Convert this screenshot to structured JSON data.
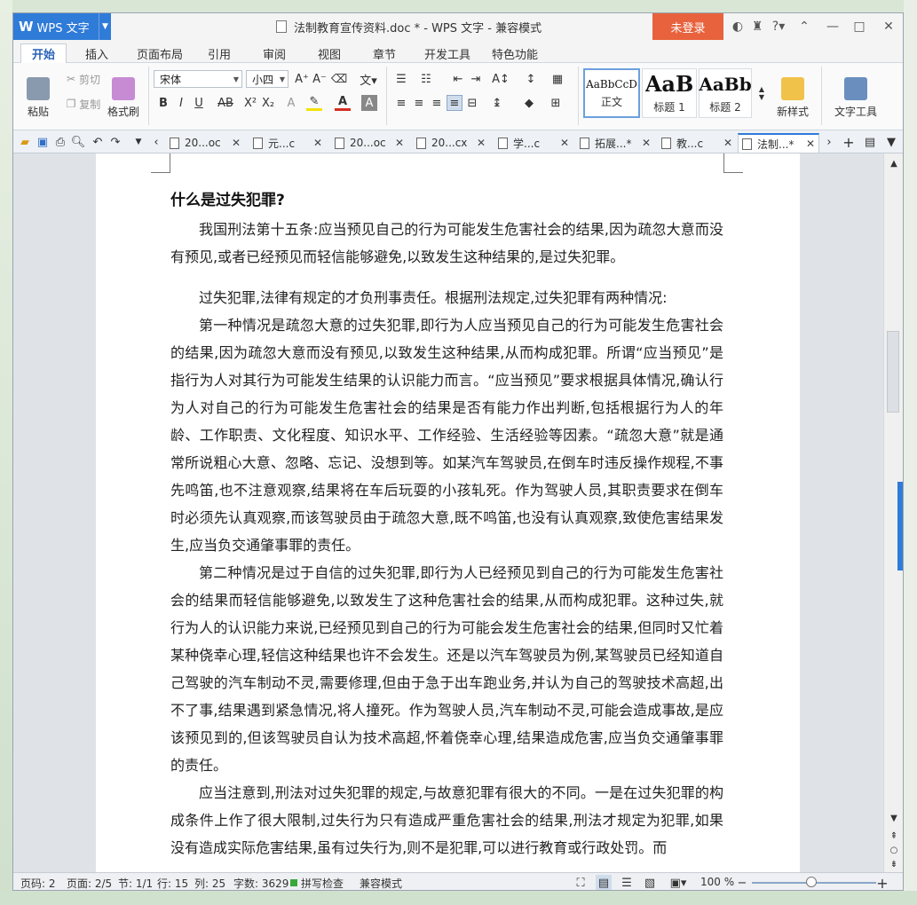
{
  "app": {
    "name": "WPS 文字",
    "logo": "W"
  },
  "window": {
    "title": "法制教育宣传资料.doc * - WPS 文字 - 兼容模式",
    "login": "未登录"
  },
  "ribbon_tabs": [
    "开始",
    "插入",
    "页面布局",
    "引用",
    "审阅",
    "视图",
    "章节",
    "开发工具",
    "特色功能"
  ],
  "clipboard": {
    "paste": "粘贴",
    "cut": "剪切",
    "copy": "复制",
    "format_painter": "格式刷"
  },
  "font": {
    "family": "宋体",
    "size": "小四"
  },
  "styles": [
    {
      "sample": "AaBbCcD",
      "name": "正文"
    },
    {
      "sample": "AaB",
      "name": "标题 1"
    },
    {
      "sample": "AaBb",
      "name": "标题 2"
    }
  ],
  "new_style": "新样式",
  "text_tools": "文字工具",
  "doc_tabs": [
    "20...oc",
    "元...c",
    "20...oc",
    "20...cx",
    "学...c",
    "拓展...*",
    "教...c",
    "法制...*"
  ],
  "document": {
    "heading": "什么是过失犯罪?",
    "paragraphs": [
      "我国刑法第十五条:应当预见自己的行为可能发生危害社会的结果,因为疏忽大意而没有预见,或者已经预见而轻信能够避免,以致发生这种结果的,是过失犯罪。",
      "过失犯罪,法律有规定的才负刑事责任。根据刑法规定,过失犯罪有两种情况:",
      "第一种情况是疏忽大意的过失犯罪,即行为人应当预见自己的行为可能发生危害社会的结果,因为疏忽大意而没有预见,以致发生这种结果,从而构成犯罪。所谓“应当预见”是指行为人对其行为可能发生结果的认识能力而言。“应当预见”要求根据具体情况,确认行为人对自己的行为可能发生危害社会的结果是否有能力作出判断,包括根据行为人的年龄、工作职责、文化程度、知识水平、工作经验、生活经验等因素。“疏忽大意”就是通常所说粗心大意、忽略、忘记、没想到等。如某汽车驾驶员,在倒车时违反操作规程,不事先鸣笛,也不注意观察,结果将在车后玩耍的小孩轧死。作为驾驶人员,其职责要求在倒车时必须先认真观察,而该驾驶员由于疏忽大意,既不鸣笛,也没有认真观察,致使危害结果发生,应当负交通肇事罪的责任。",
      "第二种情况是过于自信的过失犯罪,即行为人已经预见到自己的行为可能发生危害社会的结果而轻信能够避免,以致发生了这种危害社会的结果,从而构成犯罪。这种过失,就行为人的认识能力来说,已经预见到自己的行为可能会发生危害社会的结果,但同时又忙着某种侥幸心理,轻信这种结果也许不会发生。还是以汽车驾驶员为例,某驾驶员已经知道自己驾驶的汽车制动不灵,需要修理,但由于急于出车跑业务,并认为自己的驾驶技术高超,出不了事,结果遇到紧急情况,将人撞死。作为驾驶人员,汽车制动不灵,可能会造成事故,是应该预见到的,但该驾驶员自认为技术高超,怀着侥幸心理,结果造成危害,应当负交通肇事罪的责任。",
      "应当注意到,刑法对过失犯罪的规定,与故意犯罪有很大的不同。一是在过失犯罪的构成条件上作了很大限制,过失行为只有造成严重危害社会的结果,刑法才规定为犯罪,如果没有造成实际危害结果,虽有过失行为,则不是犯罪,可以进行教育或行政处罚。而"
    ]
  },
  "status": {
    "page_code": "页码: 2",
    "page": "页面: 2/5",
    "section": "节: 1/1",
    "line": "行: 15",
    "column": "列: 25",
    "word_count": "字数: 3629",
    "spell_check": "拼写检查",
    "compat_mode": "兼容模式",
    "zoom": "100 %"
  },
  "colors": {
    "accent": "#2f7bd8",
    "login": "#e8623d"
  }
}
